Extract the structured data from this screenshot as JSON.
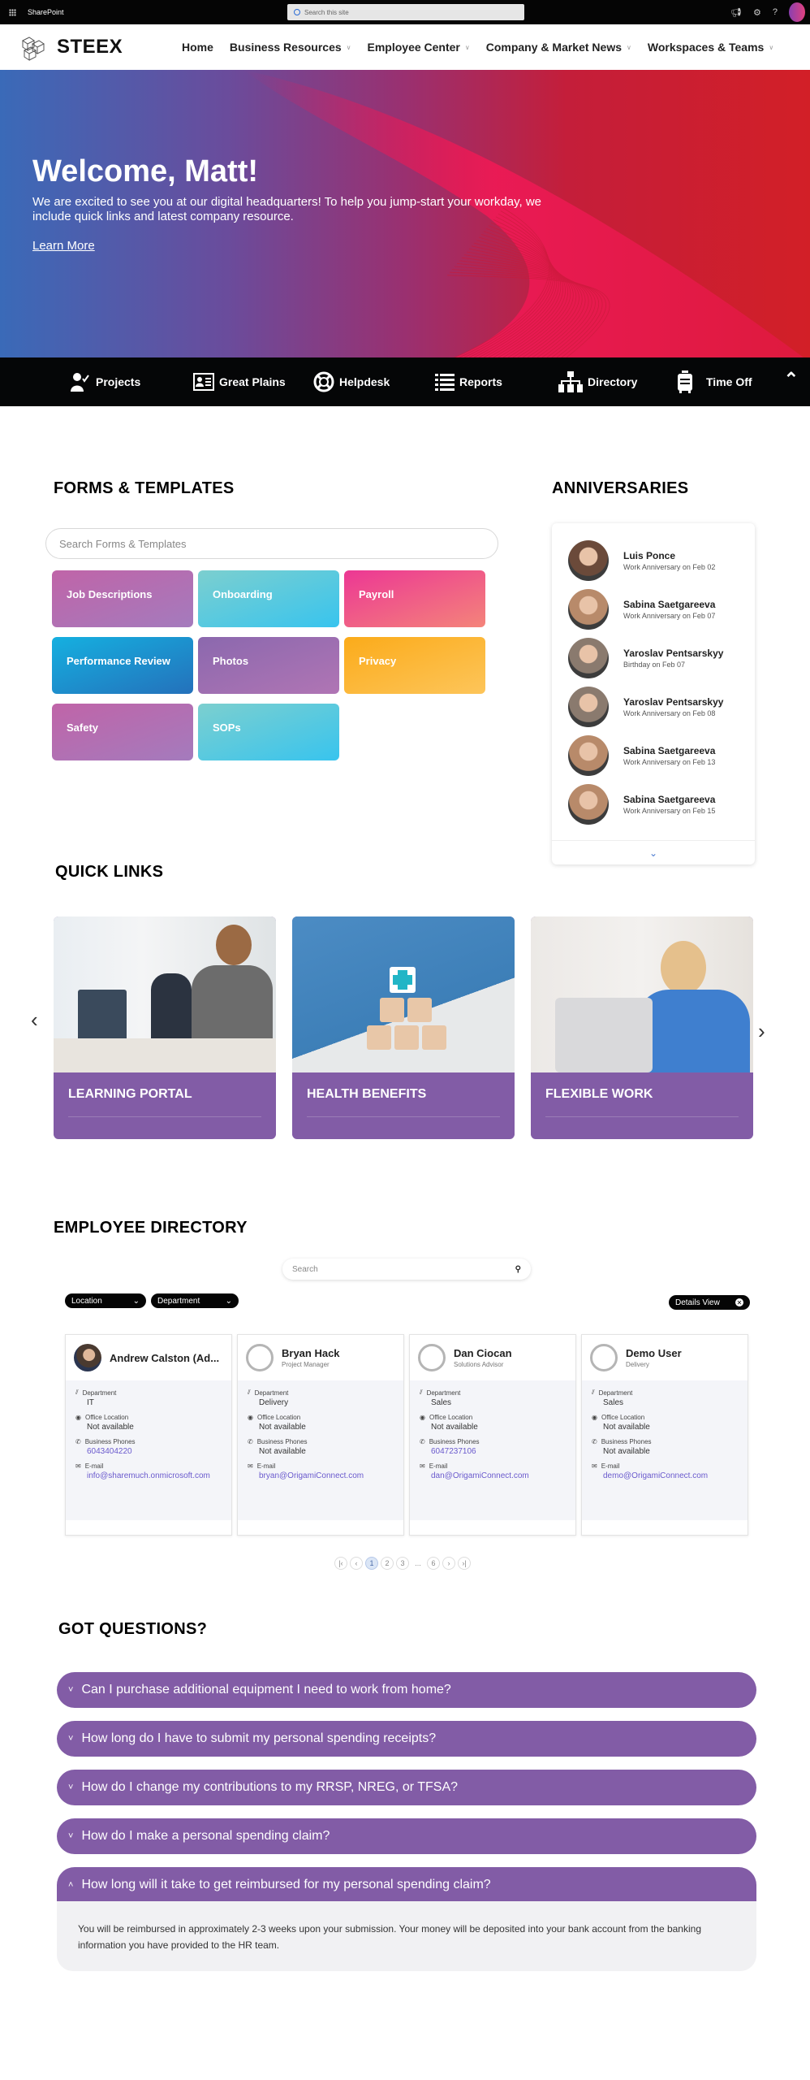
{
  "suitebar": {
    "app_name": "SharePoint",
    "search_placeholder": "Search this site",
    "icons": [
      "megaphone-icon",
      "settings-icon",
      "help-icon",
      "user-avatar"
    ]
  },
  "header": {
    "logo_text": "STEEX",
    "nav": [
      {
        "label": "Home",
        "has_dropdown": false
      },
      {
        "label": "Business Resources",
        "has_dropdown": true
      },
      {
        "label": "Employee Center",
        "has_dropdown": true
      },
      {
        "label": "Company & Market News",
        "has_dropdown": true
      },
      {
        "label": "Workspaces & Teams",
        "has_dropdown": true
      }
    ]
  },
  "hero": {
    "title": "Welcome, Matt!",
    "subtitle": "We are excited to see you at our digital headquarters! To help you jump-start your workday, we include quick links and latest company resource.",
    "link": "Learn More"
  },
  "quickbar": {
    "items": [
      {
        "label": "Projects",
        "icon": "user-check-icon"
      },
      {
        "label": "Great Plains",
        "icon": "id-card-icon"
      },
      {
        "label": "Helpdesk",
        "icon": "lifebuoy-icon"
      },
      {
        "label": "Reports",
        "icon": "list-icon"
      },
      {
        "label": "Directory",
        "icon": "org-chart-icon"
      },
      {
        "label": "Time Off",
        "icon": "luggage-icon"
      }
    ],
    "collapse_icon": "chevron-up-icon"
  },
  "forms": {
    "heading": "FORMS & TEMPLATES",
    "search_placeholder": "Search Forms & Templates",
    "tiles": [
      {
        "label": "Job Descriptions",
        "color_from": "#c064a8",
        "color_to": "#a47bbd"
      },
      {
        "label": "Onboarding",
        "color_from": "#7ccfcf",
        "color_to": "#38c4ee"
      },
      {
        "label": "Payroll",
        "color_from": "#ec3794",
        "color_to": "#f4847a"
      },
      {
        "label": "Performance Review",
        "color_from": "#15b0e0",
        "color_to": "#2471bb"
      },
      {
        "label": "Photos",
        "color_from": "#8b68ae",
        "color_to": "#b075b4"
      },
      {
        "label": "Privacy",
        "color_from": "#fbab1a",
        "color_to": "#fdc55a"
      },
      {
        "label": "Safety",
        "color_from": "#c064a8",
        "color_to": "#a47bbd"
      },
      {
        "label": "SOPs",
        "color_from": "#7ccfcf",
        "color_to": "#38c4ee"
      }
    ]
  },
  "anniversaries": {
    "heading": "ANNIVERSARIES",
    "items": [
      {
        "name": "Luis Ponce",
        "event": "Work Anniversary on Feb 02"
      },
      {
        "name": "Sabina Saetgareeva",
        "event": "Work Anniversary on Feb 07"
      },
      {
        "name": "Yaroslav Pentsarskyy",
        "event": "Birthday on Feb 07"
      },
      {
        "name": "Yaroslav Pentsarskyy",
        "event": "Work Anniversary on Feb 08"
      },
      {
        "name": "Sabina Saetgareeva",
        "event": "Work Anniversary on Feb 13"
      },
      {
        "name": "Sabina Saetgareeva",
        "event": "Work Anniversary on Feb 15"
      }
    ],
    "more_icon": "chevron-down-icon"
  },
  "quick_links": {
    "heading": "QUICK LINKS",
    "cards": [
      {
        "label": "LEARNING PORTAL"
      },
      {
        "label": "HEALTH BENEFITS"
      },
      {
        "label": "FLEXIBLE WORK"
      }
    ],
    "prev": "‹",
    "next": "›",
    "card_color": "#825ca6"
  },
  "directory": {
    "heading": "EMPLOYEE DIRECTORY",
    "search_placeholder": "Search",
    "filters": [
      {
        "label": "Location"
      },
      {
        "label": "Department"
      }
    ],
    "details_view": "Details View",
    "field_labels": {
      "department": "Department",
      "office": "Office Location",
      "phones": "Business Phones",
      "email": "E-mail"
    },
    "employees": [
      {
        "name": "Andrew Calston (Ad...",
        "title": "",
        "department": "IT",
        "office": "Not available",
        "phone": "6043404220",
        "email": "info@sharemuch.onmicrosoft.com",
        "has_photo": true
      },
      {
        "name": "Bryan Hack",
        "title": "Project Manager",
        "department": "Delivery",
        "office": "Not available",
        "phone": "Not available",
        "email": "bryan@OrigamiConnect.com",
        "has_photo": false
      },
      {
        "name": "Dan Ciocan",
        "title": "Solutions Advisor",
        "department": "Sales",
        "office": "Not available",
        "phone": "6047237106",
        "email": "dan@OrigamiConnect.com",
        "has_photo": false
      },
      {
        "name": "Demo User",
        "title": "Delivery",
        "department": "Sales",
        "office": "Not available",
        "phone": "Not available",
        "email": "demo@OrigamiConnect.com",
        "has_photo": false
      }
    ],
    "pagination": {
      "first": "|‹",
      "prev": "‹",
      "pages": [
        "1",
        "2",
        "3"
      ],
      "ellipsis": "...",
      "last_page": "6",
      "next": "›",
      "last": "›|",
      "current": "1"
    }
  },
  "faq": {
    "heading": "GOT QUESTIONS?",
    "items": [
      {
        "question": "Can I purchase additional equipment I need to work from home?",
        "expanded": false
      },
      {
        "question": "How long do I have to submit my personal spending receipts?",
        "expanded": false
      },
      {
        "question": "How do I change my contributions to my RRSP, NREG, or TFSA?",
        "expanded": false
      },
      {
        "question": "How do I make a personal spending claim?",
        "expanded": false
      },
      {
        "question": "How long will it take to get reimbursed for my personal spending claim?",
        "expanded": true,
        "answer": "You will be reimbursed in approximately 2-3 weeks upon your submission. Your money will be deposited into your bank account from the banking information you have provided to the HR team."
      }
    ],
    "chevron_closed": "˅",
    "chevron_open": "˄"
  }
}
